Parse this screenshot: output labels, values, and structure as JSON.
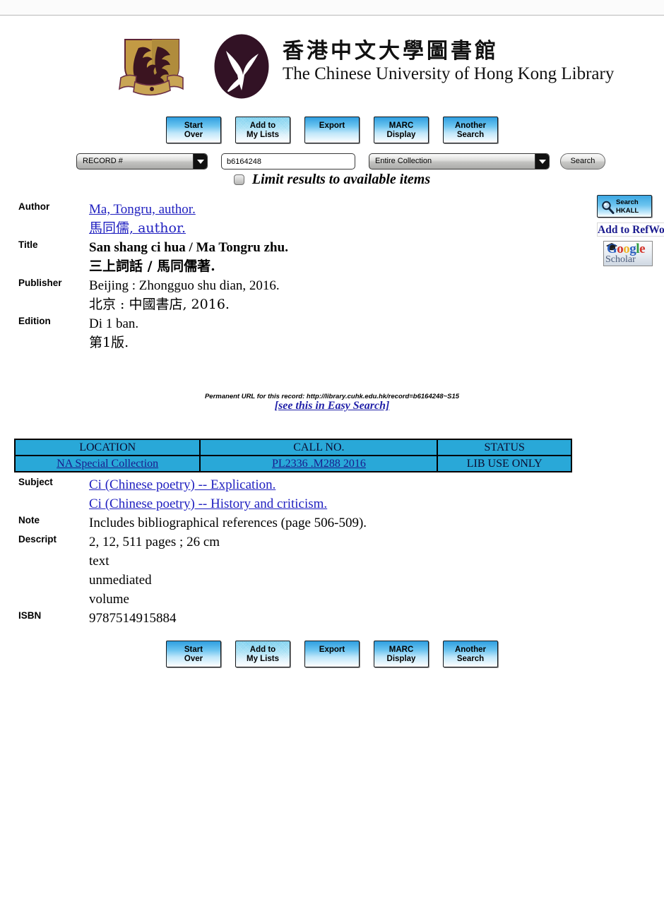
{
  "library": {
    "name_chinese": "香港中文大學圖書館",
    "name_english": "The Chinese University of Hong Kong Library",
    "shield_colors": {
      "gold": "#c8a04a",
      "dark": "#3a1220"
    },
    "bird_color": "#321225"
  },
  "toolbar": {
    "buttons": [
      {
        "label": "Start\nOver",
        "name": "start-over"
      },
      {
        "label": "Add to\nMy Lists",
        "name": "add-to-my-lists"
      },
      {
        "label": "Export",
        "name": "export"
      },
      {
        "label": "MARC\nDisplay",
        "name": "marc-display"
      },
      {
        "label": "Another\nSearch",
        "name": "another-search"
      }
    ]
  },
  "search": {
    "index_selected": "RECORD #",
    "query_value": "b6164248",
    "query_placeholder": "",
    "scope_selected": "Entire Collection",
    "submit_label": "Search",
    "limit_label": "Limit results to available items",
    "limit_checked": false
  },
  "sidebar": {
    "hkall_label": "Search\nHKALL",
    "refworks_label": "Add to RefWo",
    "gscholar_google": "Google",
    "gscholar_scholar": "Scholar",
    "gscholar_colors": {
      "G": "#2c5fbe",
      "o1": "#d4342a",
      "o2": "#f0b72c",
      "g": "#2c5fbe",
      "l": "#2b9b3e",
      "e": "#d4342a"
    }
  },
  "record": {
    "fields_top": [
      {
        "label": "Author",
        "values": [
          {
            "text": "Ma, Tongru, author.",
            "link": true,
            "cjk": false
          },
          {
            "text": "馬同儒, author.",
            "link": true,
            "cjk": true
          }
        ]
      },
      {
        "label": "Title",
        "values": [
          {
            "text": "San shang ci hua / Ma Tongru zhu.",
            "link": false,
            "bold": true,
            "cjk": false
          },
          {
            "text": "三上詞話 / 馬同儒著.",
            "link": false,
            "bold": true,
            "cjk": true
          }
        ]
      },
      {
        "label": "Publisher",
        "values": [
          {
            "text": "Beijing : Zhongguo shu dian, 2016.",
            "link": false,
            "cjk": false
          },
          {
            "text": "北京 : 中國書店, 2016.",
            "link": false,
            "cjk": true
          }
        ]
      },
      {
        "label": "Edition",
        "values": [
          {
            "text": "Di 1 ban.",
            "link": false,
            "cjk": false
          },
          {
            "text": "第1版.",
            "link": false,
            "cjk": true
          }
        ]
      }
    ],
    "permanent_url": "Permanent URL for this record: http://library.cuhk.edu.hk/record=b6164248~S15",
    "easy_search_link": "[see this in Easy Search]",
    "fields_bottom": [
      {
        "label": "Subject",
        "values": [
          {
            "text": "Ci (Chinese poetry) -- Explication.",
            "link": true,
            "cjk": false
          },
          {
            "text": "Ci (Chinese poetry) -- History and criticism.",
            "link": true,
            "cjk": false
          }
        ]
      },
      {
        "label": "Note",
        "values": [
          {
            "text": "Includes bibliographical references (page 506-509).",
            "link": false,
            "cjk": false
          }
        ]
      },
      {
        "label": "Descript",
        "values": [
          {
            "text": "2, 12, 511 pages ; 26 cm",
            "link": false,
            "cjk": false
          },
          {
            "text": "text",
            "link": false,
            "cjk": false
          },
          {
            "text": "unmediated",
            "link": false,
            "cjk": false
          },
          {
            "text": "volume",
            "link": false,
            "cjk": false
          }
        ]
      },
      {
        "label": "ISBN",
        "values": [
          {
            "text": "9787514915884",
            "link": false,
            "cjk": false
          }
        ]
      }
    ]
  },
  "holdings": {
    "headers": [
      "LOCATION",
      "CALL NO.",
      "STATUS"
    ],
    "rows": [
      {
        "location": "NA Special Collection",
        "location_link": true,
        "call_no": "PL2336 .M288 2016",
        "call_no_link": true,
        "status": "LIB USE ONLY",
        "status_link": false
      }
    ],
    "background_color": "#29a8d8"
  }
}
